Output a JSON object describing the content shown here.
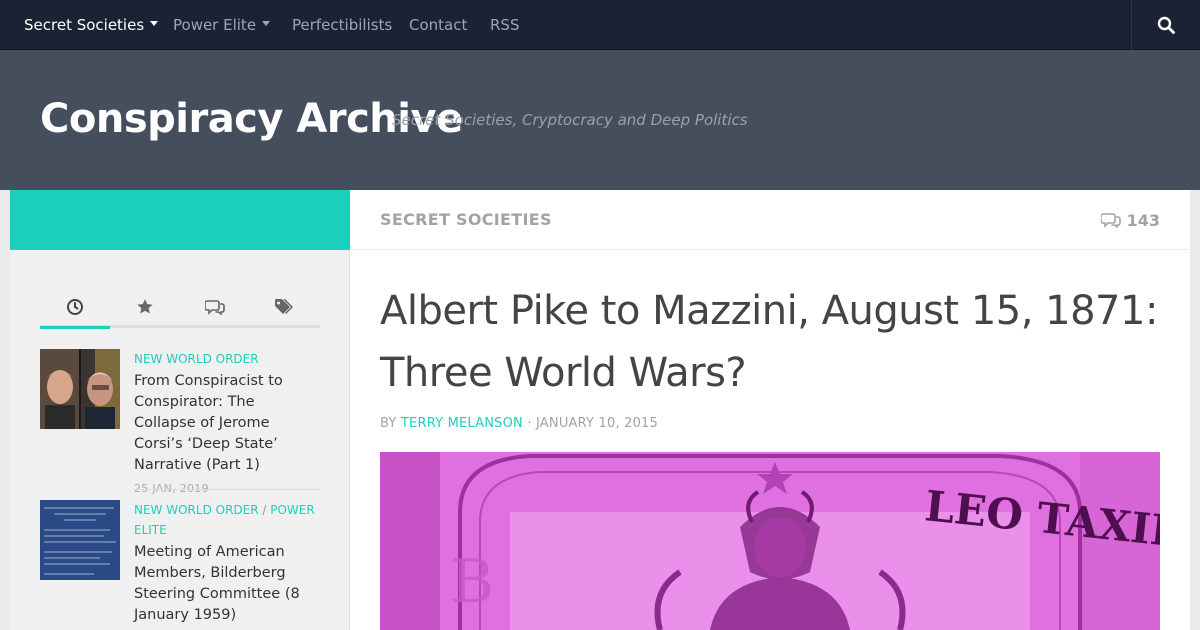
{
  "nav": {
    "items": [
      {
        "label": "Secret Societies",
        "has_dropdown": true,
        "active": true
      },
      {
        "label": "Power Elite",
        "has_dropdown": true,
        "active": false
      },
      {
        "label": "Perfectibilists",
        "has_dropdown": false,
        "active": false
      },
      {
        "label": "Contact",
        "has_dropdown": false,
        "active": false
      },
      {
        "label": "RSS",
        "has_dropdown": false,
        "active": false
      }
    ],
    "search_icon": "search-icon"
  },
  "header": {
    "site_title": "Conspiracy Archive",
    "tagline": "Secret Societies, Cryptocracy and Deep Politics"
  },
  "sidebar": {
    "tabs": [
      {
        "icon": "clock-icon",
        "active": true
      },
      {
        "icon": "star-icon",
        "active": false
      },
      {
        "icon": "comments-icon",
        "active": false
      },
      {
        "icon": "tags-icon",
        "active": false
      }
    ],
    "posts": [
      {
        "categories": [
          "NEW WORLD ORDER"
        ],
        "title": "From Conspiracist to Conspirator: The Collapse of Jerome Corsi’s ‘Deep State’ Narrative (Part 1)",
        "date": "25 JAN, 2019"
      },
      {
        "categories": [
          "NEW WORLD ORDER",
          "POWER ELITE"
        ],
        "category_separator": " / ",
        "title": "Meeting of American Members, Bilderberg Steering Committee (8 January 1959)",
        "date": ""
      }
    ]
  },
  "article": {
    "category": "SECRET SOCIETIES",
    "comment_count": "143",
    "title": "Albert Pike to Mazzini, August 15, 1871: Three World Wars?",
    "byline_prefix": "BY",
    "author": "TERRY MELANSON",
    "byline_separator": "·",
    "date": "JANUARY 10, 2015",
    "image_text": "LEO TAXIL"
  },
  "colors": {
    "accent": "#1ccfbd",
    "nav_bg": "#1a2233",
    "header_bg": "#454e5c",
    "image_tint": "#df6ee0"
  }
}
